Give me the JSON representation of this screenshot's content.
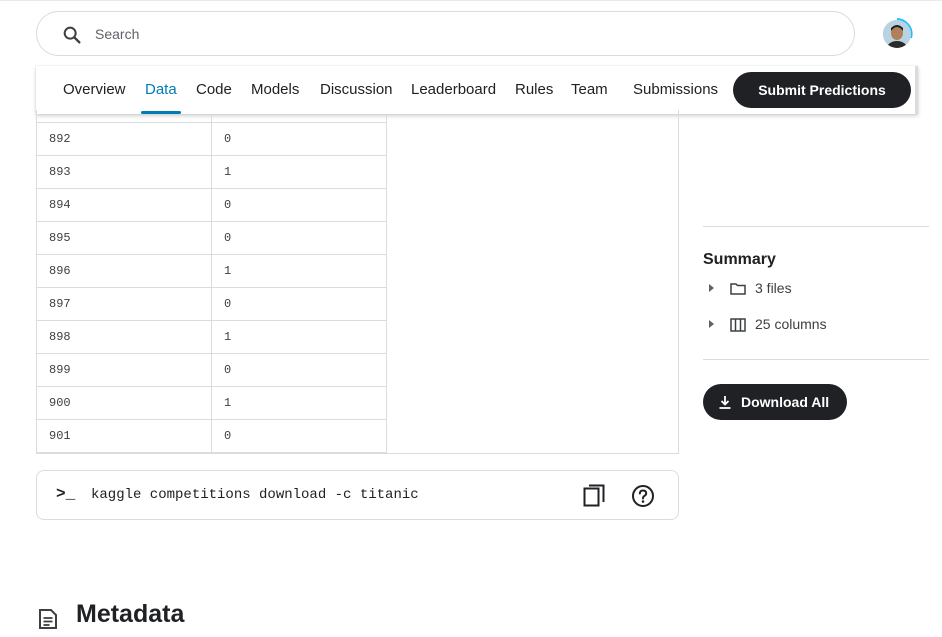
{
  "search": {
    "placeholder": "Search"
  },
  "tabs": [
    {
      "label": "Overview"
    },
    {
      "label": "Data",
      "active": true
    },
    {
      "label": "Code"
    },
    {
      "label": "Models"
    },
    {
      "label": "Discussion"
    },
    {
      "label": "Leaderboard"
    },
    {
      "label": "Rules"
    },
    {
      "label": "Team"
    },
    {
      "label": "Submissions"
    }
  ],
  "submit_label": "Submit Predictions",
  "table": {
    "rows": [
      [
        "892",
        "0"
      ],
      [
        "893",
        "1"
      ],
      [
        "894",
        "0"
      ],
      [
        "895",
        "0"
      ],
      [
        "896",
        "1"
      ],
      [
        "897",
        "0"
      ],
      [
        "898",
        "1"
      ],
      [
        "899",
        "0"
      ],
      [
        "900",
        "1"
      ],
      [
        "901",
        "0"
      ]
    ]
  },
  "command": {
    "prompt": ">_",
    "text": "kaggle competitions download -c titanic"
  },
  "metadata_title": "Metadata",
  "summary": {
    "title": "Summary",
    "files": "3 files",
    "columns": "25 columns",
    "download_label": "Download All"
  },
  "icons": {
    "search": "search-icon",
    "avatar": "user-avatar",
    "copy": "copy-icon",
    "help": "help-icon",
    "folder": "folder-icon",
    "columns": "columns-icon",
    "download": "download-icon",
    "document": "document-icon"
  },
  "colors": {
    "accent": "#007bb5",
    "dark_button": "#202124",
    "border": "#dadce0",
    "progress": "#20beff"
  }
}
